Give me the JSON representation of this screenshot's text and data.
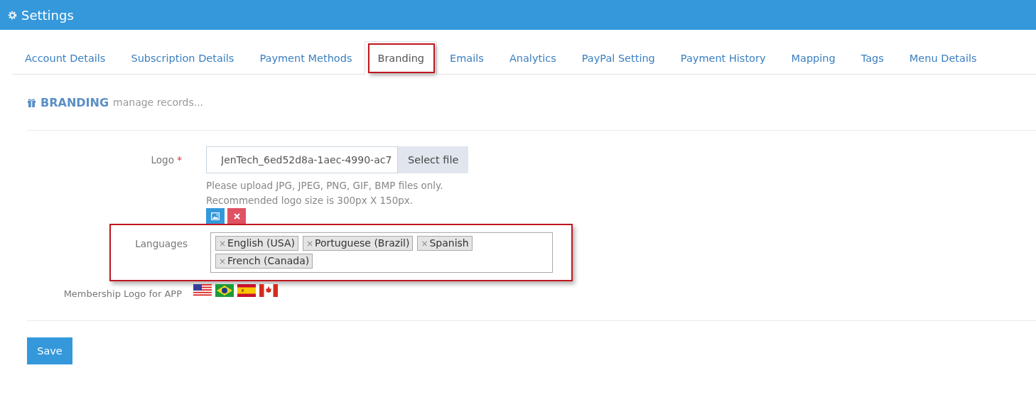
{
  "window": {
    "title": "Settings"
  },
  "tabs": [
    {
      "label": "Account Details",
      "selected": false
    },
    {
      "label": "Subscription Details",
      "selected": false
    },
    {
      "label": "Payment Methods",
      "selected": false
    },
    {
      "label": "Branding",
      "selected": true
    },
    {
      "label": "Emails",
      "selected": false
    },
    {
      "label": "Analytics",
      "selected": false
    },
    {
      "label": "PayPal Setting",
      "selected": false
    },
    {
      "label": "Payment History",
      "selected": false
    },
    {
      "label": "Mapping",
      "selected": false
    },
    {
      "label": "Tags",
      "selected": false
    },
    {
      "label": "Menu Details",
      "selected": false
    }
  ],
  "section": {
    "title": "BRANDING",
    "subtitle": "manage records..."
  },
  "logo": {
    "label": "Logo",
    "required_mark": "*",
    "value": "JenTech_6ed52d8a-1aec-4990-ac7",
    "button": "Select file",
    "hints": [
      "Please upload JPG, JPEG, PNG, GIF, BMP files only.",
      "Recommended logo size is 300px X 150px."
    ]
  },
  "languages": {
    "label": "Languages",
    "highlighted": true,
    "tags": [
      {
        "remove": "×",
        "label": "English (USA)"
      },
      {
        "remove": "×",
        "label": "Portuguese (Brazil)"
      },
      {
        "remove": "×",
        "label": "Spanish"
      },
      {
        "remove": "×",
        "label": "French (Canada)"
      }
    ]
  },
  "membership": {
    "label": "Membership Logo for APP",
    "flags": [
      {
        "kind": "us"
      },
      {
        "kind": "br"
      },
      {
        "kind": "es"
      },
      {
        "kind": "ca"
      }
    ]
  },
  "save": "Save"
}
